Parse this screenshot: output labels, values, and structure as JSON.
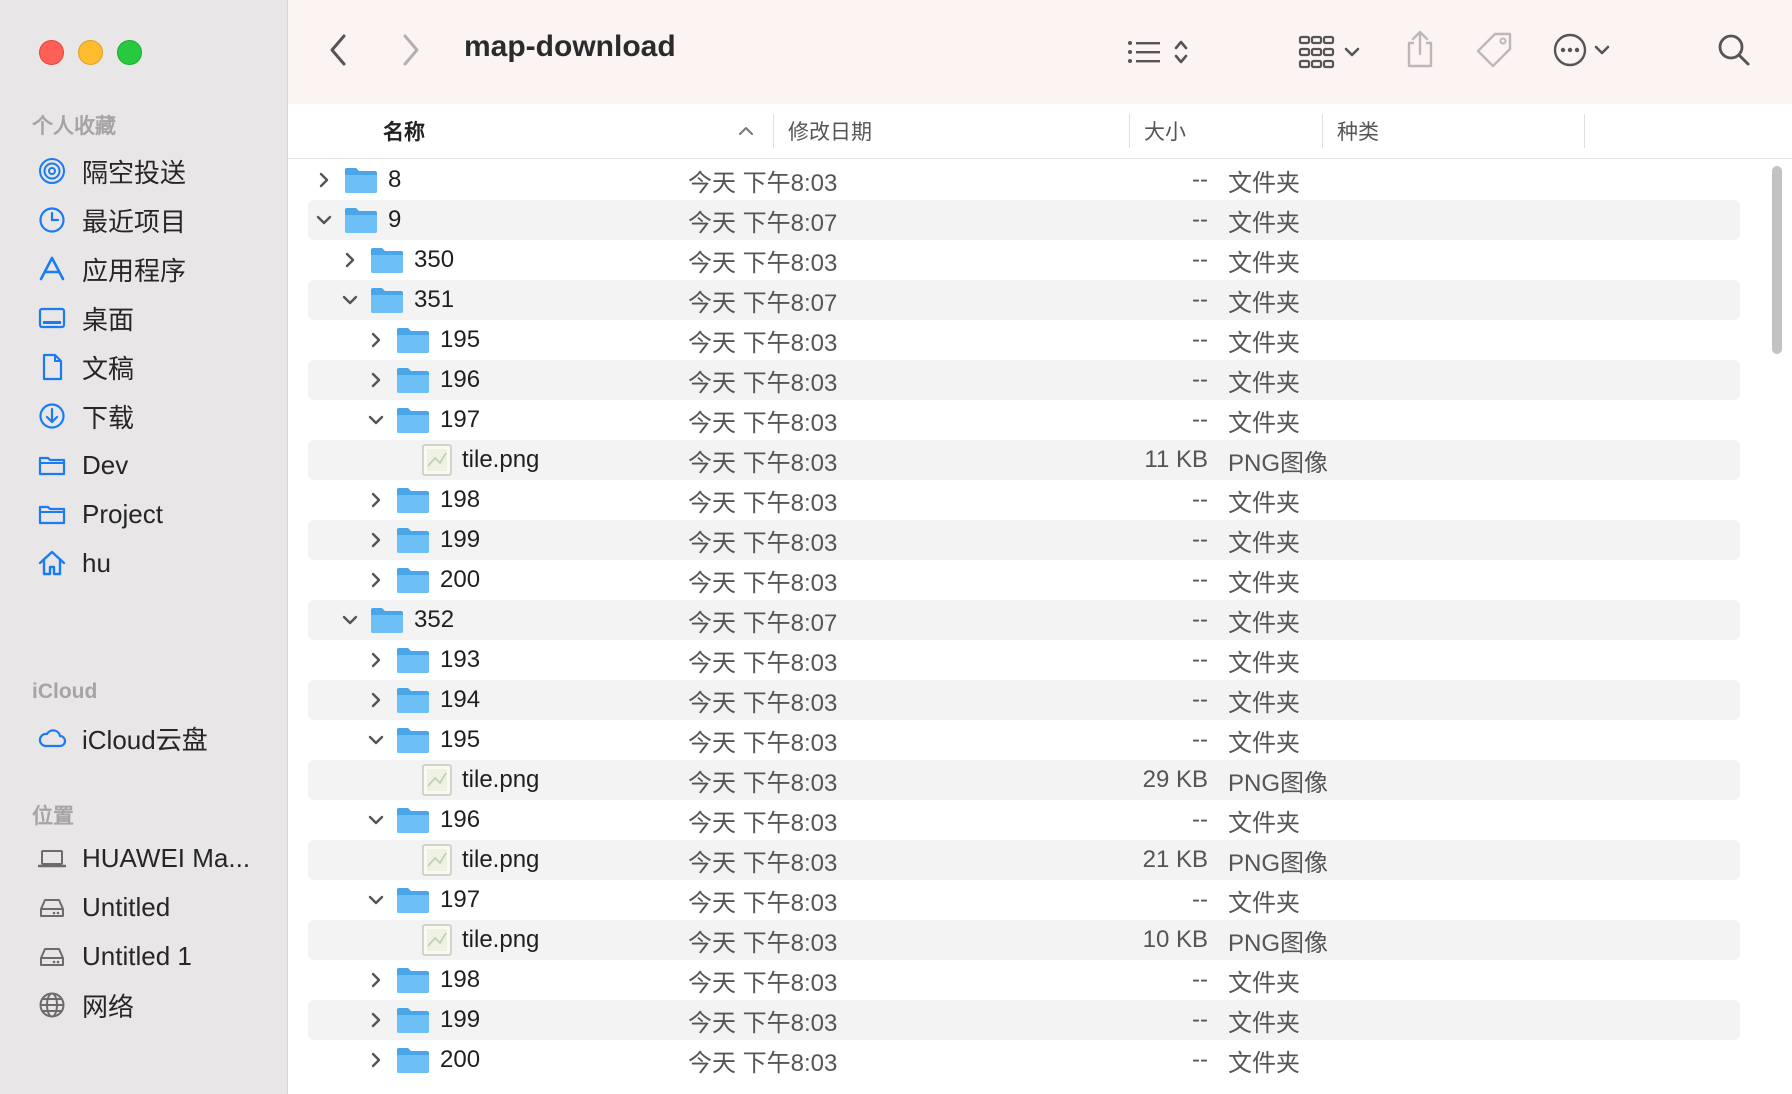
{
  "window": {
    "title": "map-download"
  },
  "sidebar": {
    "favorites_header": "个人收藏",
    "favorites": [
      {
        "label": "隔空投送",
        "icon": "airdrop-icon"
      },
      {
        "label": "最近项目",
        "icon": "clock-icon"
      },
      {
        "label": "应用程序",
        "icon": "applications-icon"
      },
      {
        "label": "桌面",
        "icon": "desktop-icon"
      },
      {
        "label": "文稿",
        "icon": "document-icon"
      },
      {
        "label": "下载",
        "icon": "download-icon"
      },
      {
        "label": "Dev",
        "icon": "folder-icon"
      },
      {
        "label": "Project",
        "icon": "folder-icon"
      },
      {
        "label": "hu",
        "icon": "home-icon"
      }
    ],
    "icloud_header": "iCloud",
    "icloud": [
      {
        "label": "iCloud云盘",
        "icon": "cloud-icon"
      }
    ],
    "locations_header": "位置",
    "locations": [
      {
        "label": "HUAWEI Ma...",
        "icon": "laptop-icon"
      },
      {
        "label": "Untitled",
        "icon": "drive-icon"
      },
      {
        "label": "Untitled 1",
        "icon": "drive-icon"
      },
      {
        "label": "网络",
        "icon": "network-icon"
      }
    ]
  },
  "columns": {
    "name": "名称",
    "date": "修改日期",
    "size": "大小",
    "kind": "种类"
  },
  "rows": [
    {
      "name": "8",
      "level": 0,
      "type": "folder",
      "expanded": false,
      "date": "今天 下午8:03",
      "size": "--",
      "kind": "文件夹"
    },
    {
      "name": "9",
      "level": 0,
      "type": "folder",
      "expanded": true,
      "date": "今天 下午8:07",
      "size": "--",
      "kind": "文件夹"
    },
    {
      "name": "350",
      "level": 1,
      "type": "folder",
      "expanded": false,
      "date": "今天 下午8:03",
      "size": "--",
      "kind": "文件夹"
    },
    {
      "name": "351",
      "level": 1,
      "type": "folder",
      "expanded": true,
      "date": "今天 下午8:07",
      "size": "--",
      "kind": "文件夹"
    },
    {
      "name": "195",
      "level": 2,
      "type": "folder",
      "expanded": false,
      "date": "今天 下午8:03",
      "size": "--",
      "kind": "文件夹"
    },
    {
      "name": "196",
      "level": 2,
      "type": "folder",
      "expanded": false,
      "date": "今天 下午8:03",
      "size": "--",
      "kind": "文件夹"
    },
    {
      "name": "197",
      "level": 2,
      "type": "folder",
      "expanded": true,
      "date": "今天 下午8:03",
      "size": "--",
      "kind": "文件夹"
    },
    {
      "name": "tile.png",
      "level": 3,
      "type": "file",
      "expanded": false,
      "date": "今天 下午8:03",
      "size": "11 KB",
      "kind": "PNG图像"
    },
    {
      "name": "198",
      "level": 2,
      "type": "folder",
      "expanded": false,
      "date": "今天 下午8:03",
      "size": "--",
      "kind": "文件夹"
    },
    {
      "name": "199",
      "level": 2,
      "type": "folder",
      "expanded": false,
      "date": "今天 下午8:03",
      "size": "--",
      "kind": "文件夹"
    },
    {
      "name": "200",
      "level": 2,
      "type": "folder",
      "expanded": false,
      "date": "今天 下午8:03",
      "size": "--",
      "kind": "文件夹"
    },
    {
      "name": "352",
      "level": 1,
      "type": "folder",
      "expanded": true,
      "date": "今天 下午8:07",
      "size": "--",
      "kind": "文件夹"
    },
    {
      "name": "193",
      "level": 2,
      "type": "folder",
      "expanded": false,
      "date": "今天 下午8:03",
      "size": "--",
      "kind": "文件夹"
    },
    {
      "name": "194",
      "level": 2,
      "type": "folder",
      "expanded": false,
      "date": "今天 下午8:03",
      "size": "--",
      "kind": "文件夹"
    },
    {
      "name": "195",
      "level": 2,
      "type": "folder",
      "expanded": true,
      "date": "今天 下午8:03",
      "size": "--",
      "kind": "文件夹"
    },
    {
      "name": "tile.png",
      "level": 3,
      "type": "file",
      "expanded": false,
      "date": "今天 下午8:03",
      "size": "29 KB",
      "kind": "PNG图像"
    },
    {
      "name": "196",
      "level": 2,
      "type": "folder",
      "expanded": true,
      "date": "今天 下午8:03",
      "size": "--",
      "kind": "文件夹"
    },
    {
      "name": "tile.png",
      "level": 3,
      "type": "file",
      "expanded": false,
      "date": "今天 下午8:03",
      "size": "21 KB",
      "kind": "PNG图像"
    },
    {
      "name": "197",
      "level": 2,
      "type": "folder",
      "expanded": true,
      "date": "今天 下午8:03",
      "size": "--",
      "kind": "文件夹"
    },
    {
      "name": "tile.png",
      "level": 3,
      "type": "file",
      "expanded": false,
      "date": "今天 下午8:03",
      "size": "10 KB",
      "kind": "PNG图像"
    },
    {
      "name": "198",
      "level": 2,
      "type": "folder",
      "expanded": false,
      "date": "今天 下午8:03",
      "size": "--",
      "kind": "文件夹"
    },
    {
      "name": "199",
      "level": 2,
      "type": "folder",
      "expanded": false,
      "date": "今天 下午8:03",
      "size": "--",
      "kind": "文件夹"
    },
    {
      "name": "200",
      "level": 2,
      "type": "folder",
      "expanded": false,
      "date": "今天 下午8:03",
      "size": "--",
      "kind": "文件夹"
    }
  ],
  "colors": {
    "accent": "#1a7cf5",
    "folder": "#5ab3f0",
    "sidebar_bg": "#e9e6e7",
    "toolbar_bg": "#fcf3f3"
  }
}
